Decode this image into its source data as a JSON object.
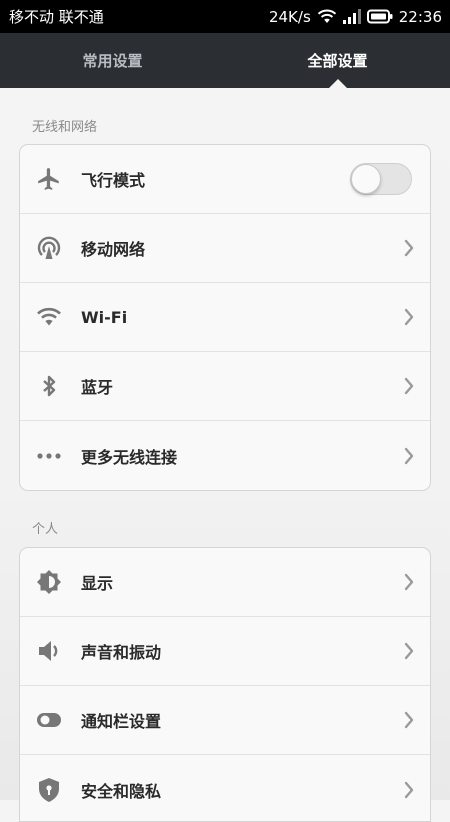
{
  "status_bar": {
    "carrier": "移不动 联不通",
    "speed": "24K/s",
    "time": "22:36",
    "icons": [
      "wifi-icon",
      "signal-icon",
      "battery-icon"
    ]
  },
  "tabs": [
    {
      "label": "常用设置",
      "active": false
    },
    {
      "label": "全部设置",
      "active": true
    }
  ],
  "sections": [
    {
      "header": "无线和网络",
      "items": [
        {
          "label": "飞行模式",
          "icon": "airplane-icon",
          "control": "toggle",
          "value": "off"
        },
        {
          "label": "移动网络",
          "icon": "mobile-network-icon",
          "control": "chevron"
        },
        {
          "label": "Wi-Fi",
          "icon": "wifi-icon",
          "control": "chevron"
        },
        {
          "label": "蓝牙",
          "icon": "bluetooth-icon",
          "control": "chevron"
        },
        {
          "label": "更多无线连接",
          "icon": "more-icon",
          "control": "chevron"
        }
      ]
    },
    {
      "header": "个人",
      "items": [
        {
          "label": "显示",
          "icon": "brightness-icon",
          "control": "chevron"
        },
        {
          "label": "声音和振动",
          "icon": "speaker-icon",
          "control": "chevron"
        },
        {
          "label": "通知栏设置",
          "icon": "notification-toggle-icon",
          "control": "chevron"
        },
        {
          "label": "安全和隐私",
          "icon": "shield-icon",
          "control": "chevron"
        }
      ]
    }
  ],
  "colors": {
    "tabbar_bg": "#2b2e33",
    "status_bg": "#000000",
    "icon_gray": "#777777"
  }
}
